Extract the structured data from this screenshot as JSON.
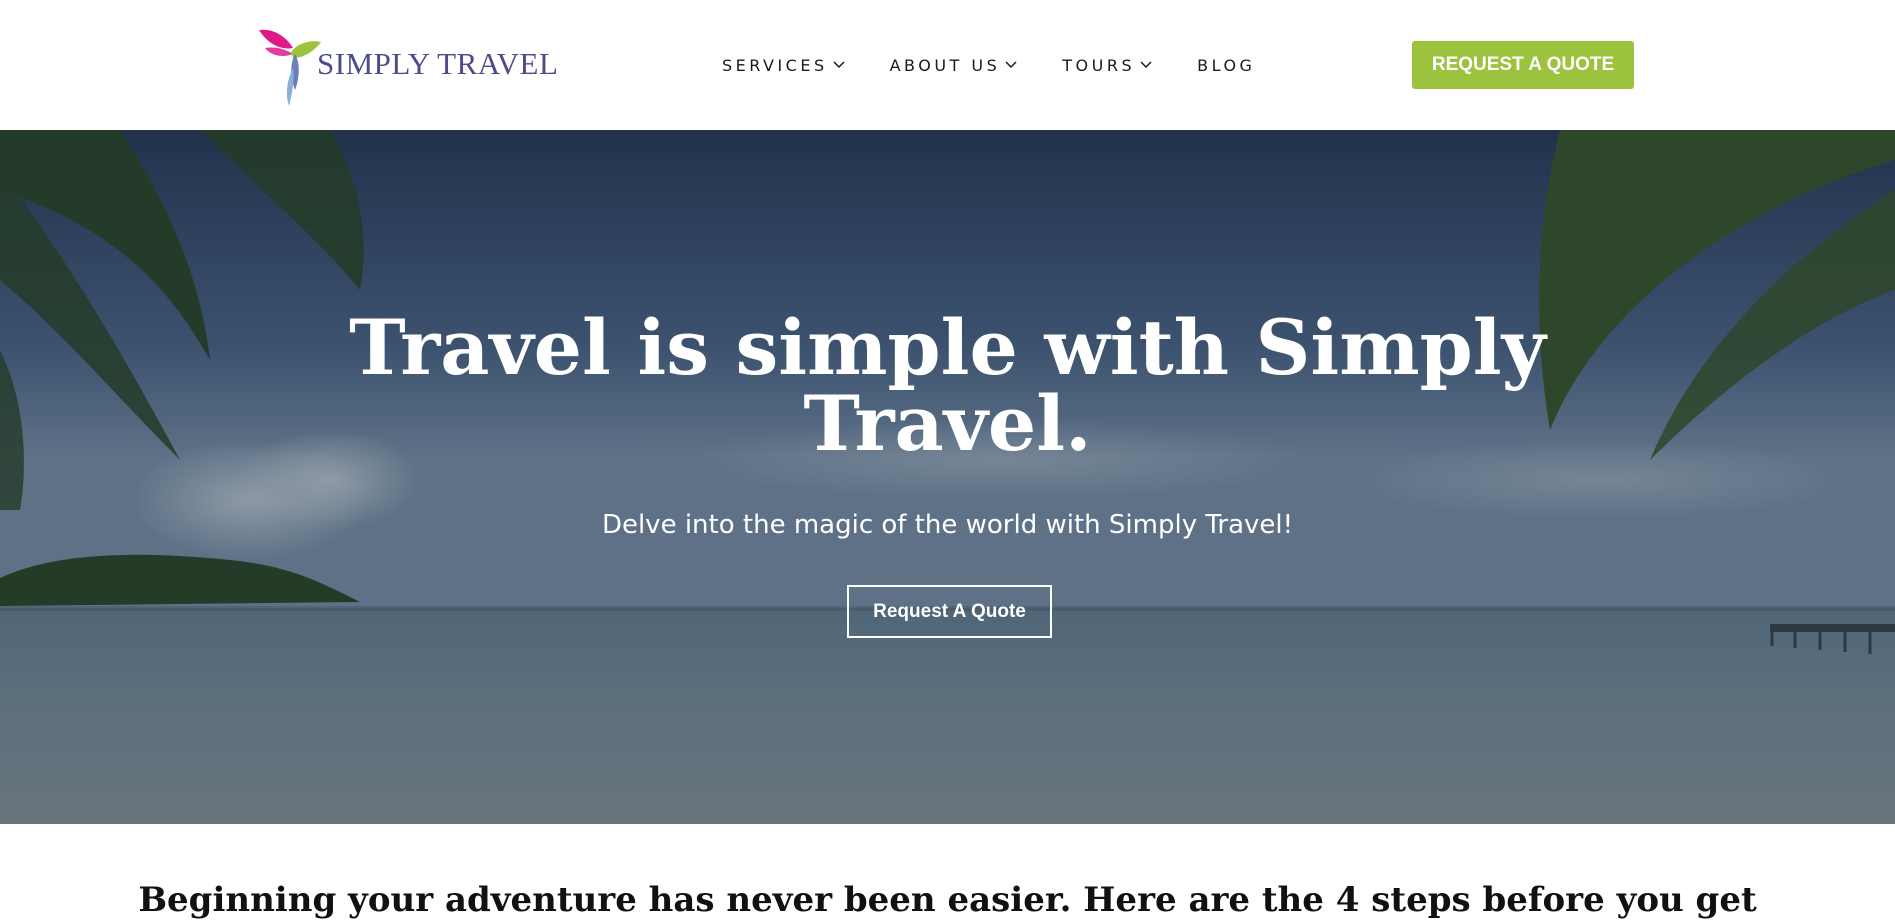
{
  "brand": {
    "name": "SIMPLY TRAVEL",
    "color": "#4b4d8a",
    "accent_pink": "#e0198a",
    "accent_green": "#9bc33d"
  },
  "nav": {
    "items": [
      {
        "label": "SERVICES",
        "has_dropdown": true
      },
      {
        "label": "ABOUT US",
        "has_dropdown": true
      },
      {
        "label": "TOURS",
        "has_dropdown": true
      },
      {
        "label": "BLOG",
        "has_dropdown": false
      }
    ],
    "cta_label": "REQUEST A QUOTE",
    "cta_color": "#9bc33d"
  },
  "hero": {
    "title": "Travel is simple with Simply Travel.",
    "subtitle": "Delve into the magic of the world with Simply Travel!",
    "cta_label": "Request A Quote"
  },
  "steps": {
    "heading": "Beginning your adventure has never been easier. Here are the 4 steps before you get"
  }
}
